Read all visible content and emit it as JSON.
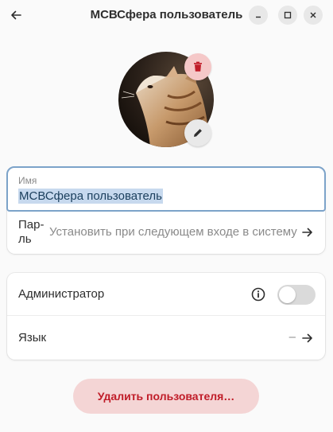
{
  "window": {
    "title": "МСВСфера пользователь",
    "controls": [
      "minimize-icon",
      "maximize-icon",
      "close-icon"
    ]
  },
  "avatar": {
    "alt": "cat-photo",
    "delete_icon": "trash-icon",
    "edit_icon": "pencil-icon"
  },
  "account": {
    "name_label": "Имя",
    "name_value": "МСВСфера пользователь",
    "password_label": "Пар-ль",
    "password_label_line1": "Пар-",
    "password_label_line2": "ль",
    "password_value": "Установить при следующем входе в систему"
  },
  "settings": {
    "admin_label": "Администратор",
    "admin_enabled": false,
    "language_label": "Язык",
    "language_value": "–"
  },
  "actions": {
    "delete_label": "Удалить пользователя…"
  },
  "colors": {
    "focus_ring": "#7ca3c9",
    "selection": "#c7d9ee",
    "destructive": "#c01c28",
    "destructive_bg": "#f4d5d5"
  }
}
